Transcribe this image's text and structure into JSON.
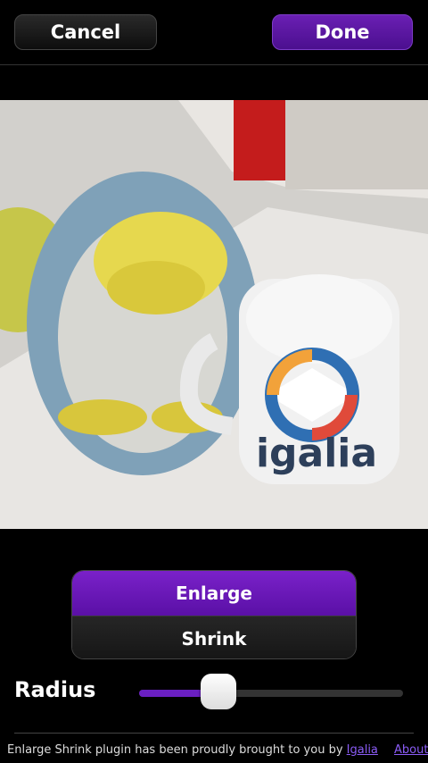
{
  "header": {
    "cancel_label": "Cancel",
    "done_label": "Done"
  },
  "image": {
    "logo_text": "igalia"
  },
  "mode": {
    "options": [
      "Enlarge",
      "Shrink"
    ],
    "selected": "Enlarge"
  },
  "radius": {
    "label": "Radius",
    "value": 0.3
  },
  "footer": {
    "credit_text": "Enlarge Shrink plugin has been proudly brought to you by",
    "credit_link": "Igalia",
    "about_label": "About"
  },
  "colors": {
    "accent": "#6a1fb3",
    "background": "#000000"
  }
}
